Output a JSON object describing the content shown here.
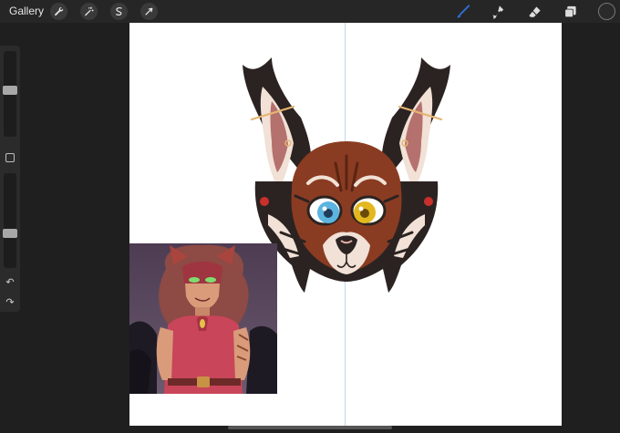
{
  "topbar": {
    "gallery_label": "Gallery",
    "left_tools": [
      "wrench-icon",
      "magic-wand-icon",
      "selection-icon",
      "transform-arrow-icon"
    ],
    "right_tools": [
      "brush-icon",
      "smudge-icon",
      "eraser-icon",
      "layers-icon"
    ],
    "active_tool": "brush-icon",
    "accent_color": "#2f6fd6",
    "current_color": "#2a2a2a"
  },
  "sidebar": {
    "brush_size_level": 0.55,
    "opacity_level": 0.35,
    "tools": [
      "modify-square-icon",
      "undo-icon",
      "redo-icon"
    ]
  },
  "canvas": {
    "background": "#ffffff",
    "symmetry_guide": "vertical"
  },
  "artwork": {
    "fur_brown": "#8a3c22",
    "fur_dark": "#2b2321",
    "fur_cream": "#f1e1d6",
    "eye_left": "#5cb4e0",
    "eye_right": "#e3b81f",
    "ear_inner": "#b5716d"
  },
  "reference_image": {
    "sky_color": "#4d3c52",
    "hair_color": "#8e4a44",
    "outfit_color": "#c8455a"
  }
}
